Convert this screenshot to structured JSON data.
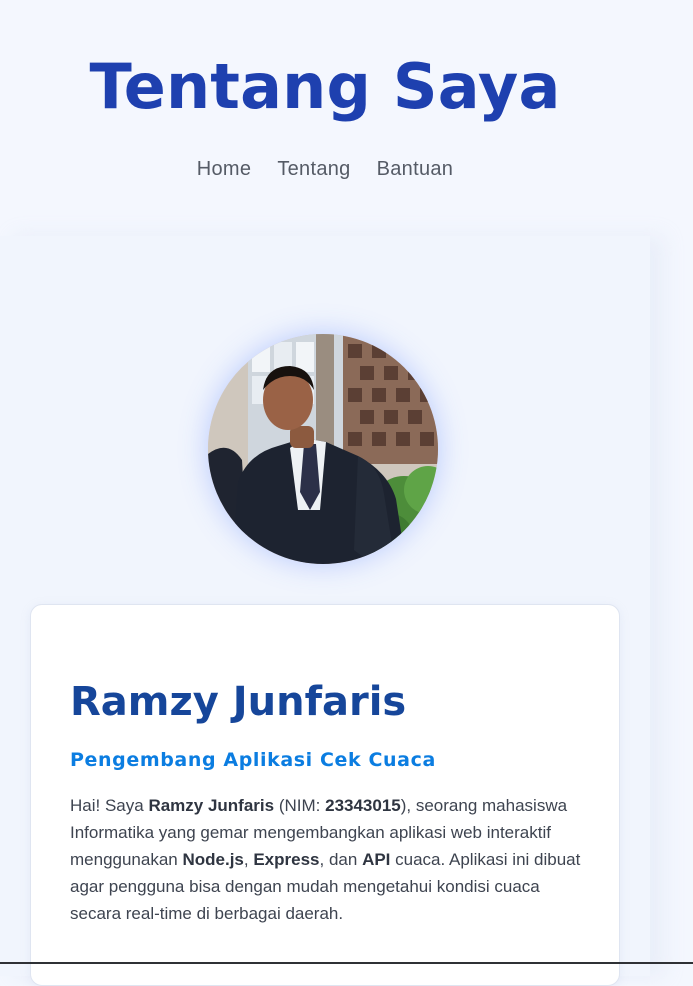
{
  "header": {
    "title": "Tentang Saya",
    "nav": [
      "Home",
      "Tentang",
      "Bantuan"
    ]
  },
  "profile": {
    "name": "Ramzy Junfaris",
    "role": "Pengembang Aplikasi Cek Cuaca",
    "bio": {
      "p1": "Hai! Saya ",
      "name": "Ramzy Junfaris",
      "p2": " (NIM: ",
      "nim": "23343015",
      "p3": "), seorang mahasiswa Informatika yang gemar mengembangkan aplikasi web interaktif menggunakan ",
      "tech1": "Node.js",
      "p4": ", ",
      "tech2": "Express",
      "p5": ", dan ",
      "tech3": "API",
      "p6": " cuaca. Aplikasi ini dibuat agar pengguna bisa dengan mudah mengetahui kondisi cuaca secara real-time di berbagai daerah."
    },
    "avatar": "profile-photo"
  },
  "colors": {
    "title": "#1e40af",
    "name": "#16469a",
    "role": "#0b7de1",
    "background": "#f4f7fe"
  }
}
